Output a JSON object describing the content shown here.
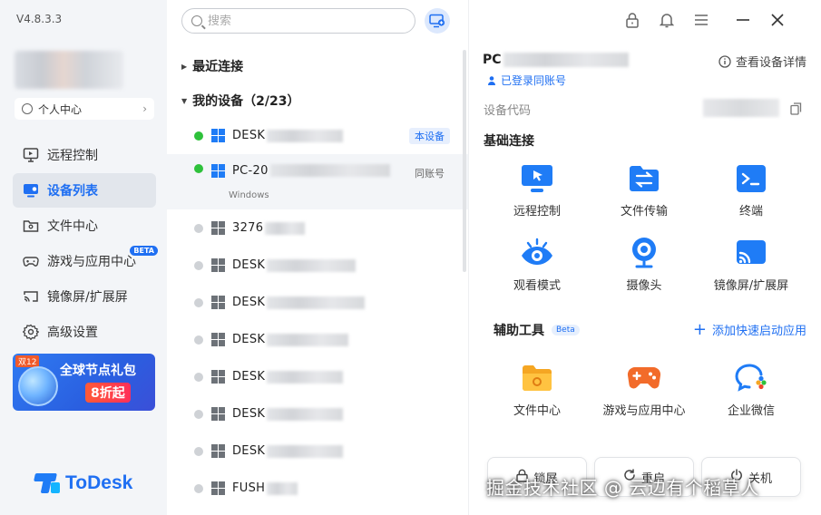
{
  "app": {
    "version": "V4.8.3.3",
    "brand": "ToDesk"
  },
  "sidebar": {
    "user_center": "个人中心",
    "items": [
      {
        "label": "远程控制"
      },
      {
        "label": "设备列表"
      },
      {
        "label": "文件中心"
      },
      {
        "label": "游戏与应用中心",
        "badge": "BETA"
      },
      {
        "label": "镜像屏/扩展屏"
      },
      {
        "label": "高级设置"
      }
    ],
    "promo": {
      "tag": "双12",
      "title": "全球节点礼包",
      "discount": "8折起"
    }
  },
  "search": {
    "placeholder": "搜索"
  },
  "device_groups": {
    "recent": "最近连接",
    "mine": "我的设备（2/23）"
  },
  "devices": [
    {
      "name": "DESK",
      "online": true,
      "badge": "本设备"
    },
    {
      "name": "PC-20",
      "online": true,
      "badge": "同账号",
      "os": "Windows"
    },
    {
      "name": "3276",
      "online": false
    },
    {
      "name": "DESK",
      "online": false
    },
    {
      "name": "DESK",
      "online": false
    },
    {
      "name": "DESK",
      "online": false
    },
    {
      "name": "DESK",
      "online": false
    },
    {
      "name": "DESK",
      "online": false
    },
    {
      "name": "DESK",
      "online": false
    },
    {
      "name": "FUSH",
      "online": false
    }
  ],
  "detail": {
    "pc_name": "PC",
    "logged_in": "已登录同账号",
    "view_details": "查看设备详情",
    "code_label": "设备代码",
    "basic_title": "基础连接",
    "basic_tools": [
      {
        "label": "远程控制",
        "icon": "remote-control-icon"
      },
      {
        "label": "文件传输",
        "icon": "file-transfer-icon"
      },
      {
        "label": "终端",
        "icon": "terminal-icon"
      },
      {
        "label": "观看模式",
        "icon": "view-mode-icon"
      },
      {
        "label": "摄像头",
        "icon": "camera-icon"
      },
      {
        "label": "镜像屏/扩展屏",
        "icon": "cast-screen-icon"
      }
    ],
    "aux_title": "辅助工具",
    "aux_beta": "Beta",
    "add_quick": "添加快速启动应用",
    "aux_tools": [
      {
        "label": "文件中心",
        "icon": "folder-icon"
      },
      {
        "label": "游戏与应用中心",
        "icon": "gamepad-icon"
      },
      {
        "label": "企业微信",
        "icon": "wecom-icon"
      }
    ],
    "actions": {
      "lock": "锁屏",
      "restart": "重启",
      "shutdown": "关机"
    }
  },
  "watermark": "掘金技术社区 @ 云边有个稻草人",
  "colors": {
    "accent": "#1f6ff2",
    "online": "#2ec13b"
  }
}
